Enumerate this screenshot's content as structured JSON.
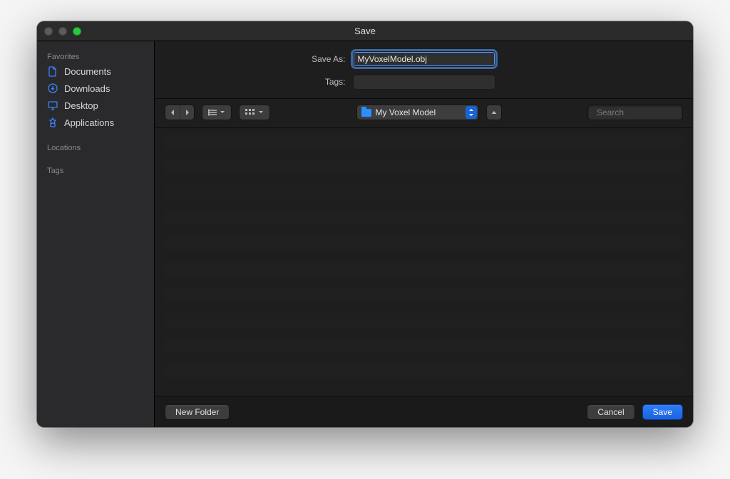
{
  "titlebar": {
    "title": "Save"
  },
  "form": {
    "save_as_label": "Save As:",
    "save_as_value": "MyVoxelModel.obj",
    "tags_label": "Tags:",
    "tags_value": ""
  },
  "sidebar": {
    "heading_favorites": "Favorites",
    "heading_locations": "Locations",
    "heading_tags": "Tags",
    "items": [
      {
        "label": "Documents",
        "icon": "document-icon"
      },
      {
        "label": "Downloads",
        "icon": "download-icon"
      },
      {
        "label": "Desktop",
        "icon": "desktop-icon"
      },
      {
        "label": "Applications",
        "icon": "applications-icon"
      }
    ]
  },
  "toolbar": {
    "folder_label": "My Voxel Model",
    "search_placeholder": "Search"
  },
  "footer": {
    "new_folder": "New Folder",
    "cancel": "Cancel",
    "save": "Save"
  }
}
